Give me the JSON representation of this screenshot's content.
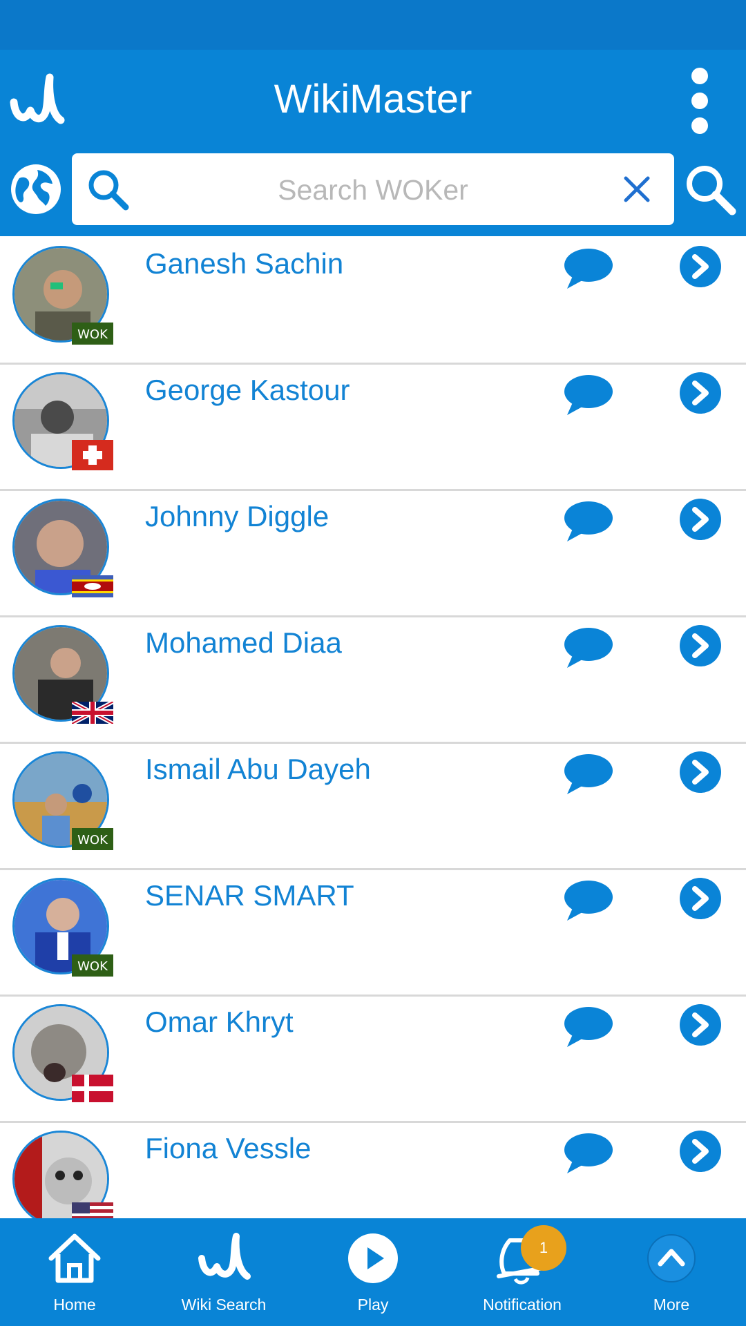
{
  "app": {
    "title": "WikiMaster"
  },
  "search": {
    "placeholder": "Search WOKer"
  },
  "users": [
    {
      "name": "Ganesh Sachin",
      "flag": "wok"
    },
    {
      "name": "George Kastour",
      "flag": "switzerland"
    },
    {
      "name": "Johnny Diggle",
      "flag": "eswatini"
    },
    {
      "name": "Mohamed Diaa",
      "flag": "united-kingdom"
    },
    {
      "name": "Ismail Abu Dayeh",
      "flag": "wok"
    },
    {
      "name": "SENAR SMART",
      "flag": "wok"
    },
    {
      "name": "Omar Khryt",
      "flag": "denmark"
    },
    {
      "name": "Fiona Vessle",
      "flag": "united-states"
    }
  ],
  "nav": {
    "home": "Home",
    "wiki_search": "Wiki Search",
    "play": "Play",
    "notification": "Notification",
    "more": "More",
    "notification_count": "1"
  },
  "colors": {
    "primary": "#0984d6",
    "status_bar": "#0b78c9",
    "text_blue": "#1283d4",
    "badge": "#e8a11c"
  }
}
